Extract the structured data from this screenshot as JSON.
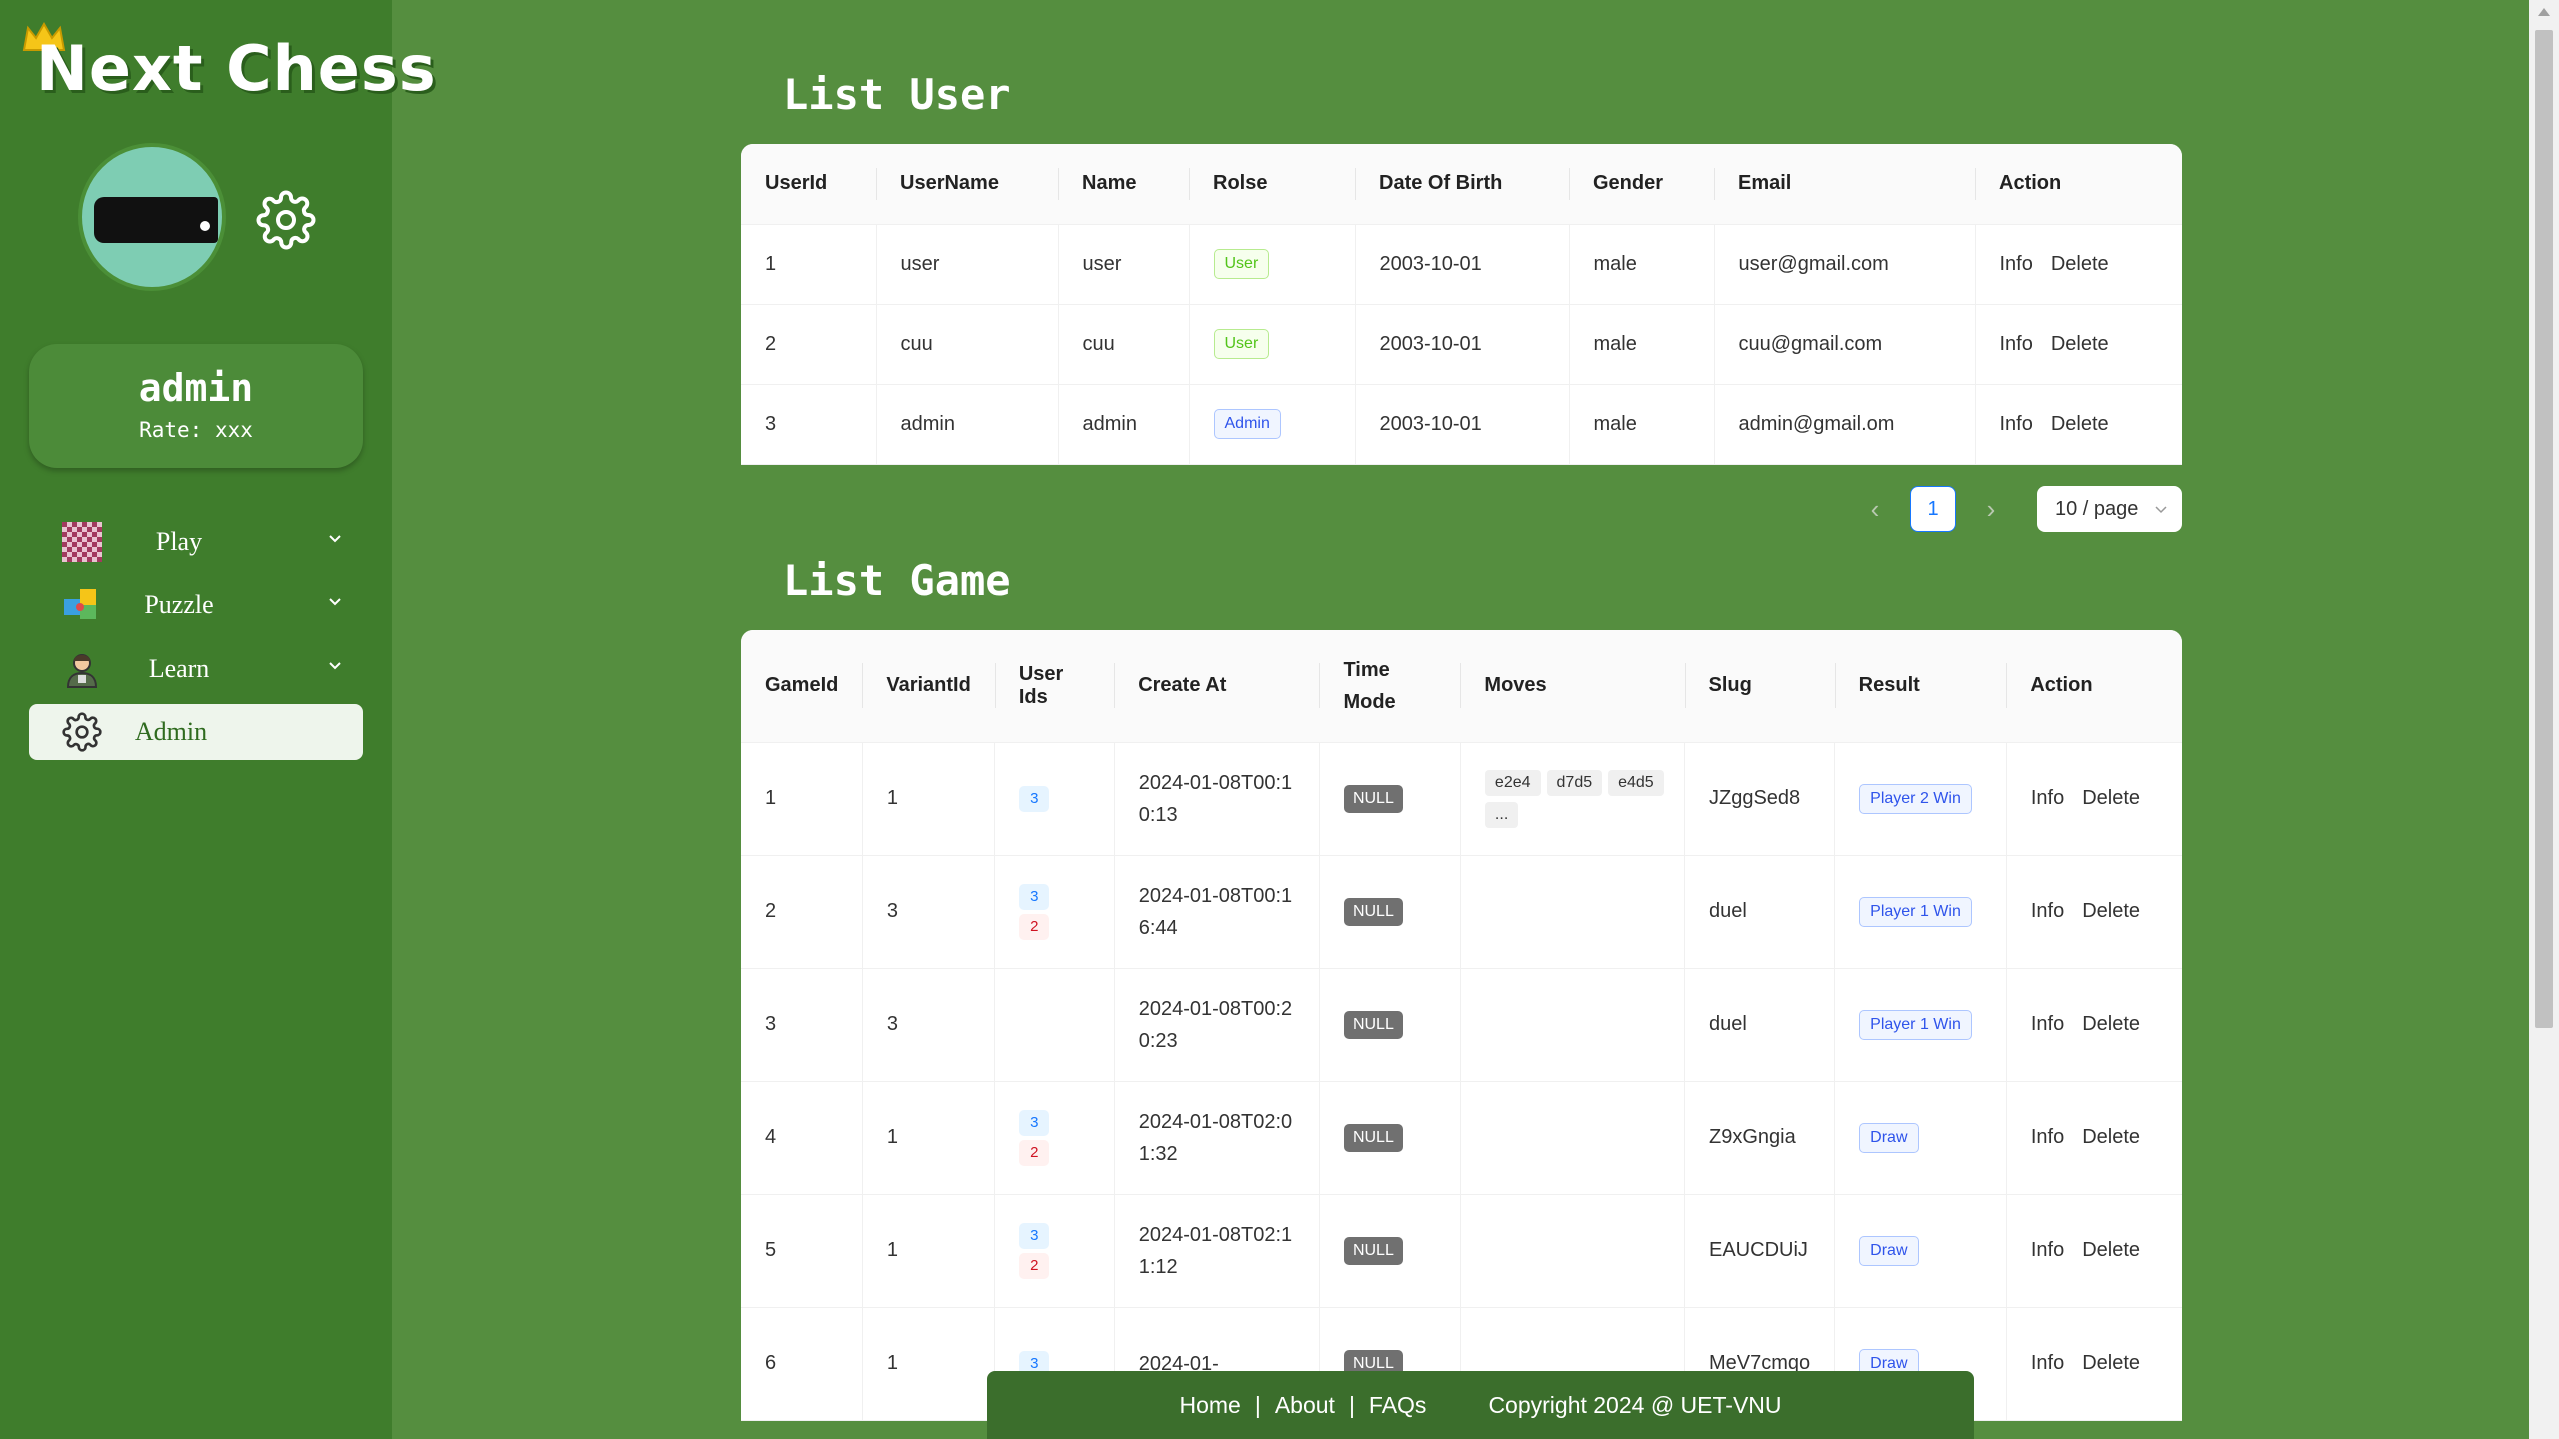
{
  "app": {
    "name": "Next Chess"
  },
  "profile": {
    "username": "admin",
    "rate": "Rate: xxx"
  },
  "nav": [
    {
      "label": "Play",
      "icon": "chessboard-icon"
    },
    {
      "label": "Puzzle",
      "icon": "puzzle-icon"
    },
    {
      "label": "Learn",
      "icon": "teacher-icon"
    },
    {
      "label": "Admin",
      "icon": "gear-icon"
    }
  ],
  "users": {
    "title": "List User",
    "columns": [
      "UserId",
      "UserName",
      "Name",
      "Rolse",
      "Date Of Birth",
      "Gender",
      "Email",
      "Action"
    ],
    "rows": [
      {
        "id": "1",
        "username": "user",
        "name": "user",
        "role": "User",
        "dob": "2003-10-01",
        "gender": "male",
        "email": "user@gmail.com"
      },
      {
        "id": "2",
        "username": "cuu",
        "name": "cuu",
        "role": "User",
        "dob": "2003-10-01",
        "gender": "male",
        "email": "cuu@gmail.com"
      },
      {
        "id": "3",
        "username": "admin",
        "name": "admin",
        "role": "Admin",
        "dob": "2003-10-01",
        "gender": "male",
        "email": "admin@gmail.om"
      }
    ],
    "actions": {
      "info": "Info",
      "delete": "Delete"
    }
  },
  "pagination": {
    "current": "1",
    "page_size": "10 / page",
    "prev": "‹",
    "next": "›"
  },
  "games": {
    "title": "List Game",
    "columns": [
      "GameId",
      "VariantId",
      "User Ids",
      "Create At",
      "Time Mode",
      "Moves",
      "Slug",
      "Result",
      "Action"
    ],
    "rows": [
      {
        "id": "1",
        "variant": "1",
        "users": [
          "3"
        ],
        "created": "2024-01-08T00:10:13",
        "time": "NULL",
        "moves": [
          "e2e4",
          "d7d5",
          "e4d5",
          "..."
        ],
        "slug": "JZggSed8",
        "result": "Player 2 Win"
      },
      {
        "id": "2",
        "variant": "3",
        "users": [
          "3",
          "2"
        ],
        "created": "2024-01-08T00:16:44",
        "time": "NULL",
        "moves": [],
        "slug": "duel",
        "result": "Player 1 Win"
      },
      {
        "id": "3",
        "variant": "3",
        "users": [],
        "created": "2024-01-08T00:20:23",
        "time": "NULL",
        "moves": [],
        "slug": "duel",
        "result": "Player 1 Win"
      },
      {
        "id": "4",
        "variant": "1",
        "users": [
          "3",
          "2"
        ],
        "created": "2024-01-08T02:01:32",
        "time": "NULL",
        "moves": [],
        "slug": "Z9xGngia",
        "result": "Draw"
      },
      {
        "id": "5",
        "variant": "1",
        "users": [
          "3",
          "2"
        ],
        "created": "2024-01-08T02:11:12",
        "time": "NULL",
        "moves": [],
        "slug": "EAUCDUiJ",
        "result": "Draw"
      },
      {
        "id": "6",
        "variant": "1",
        "users": [
          "3"
        ],
        "created": "2024-01-",
        "time": "NULL",
        "moves": [],
        "slug": "MeV7cmqo",
        "result": "Draw"
      }
    ],
    "actions": {
      "info": "Info",
      "delete": "Delete"
    }
  },
  "footer": {
    "home": "Home",
    "about": "About",
    "faqs": "FAQs",
    "sep": "|",
    "copyright": "Copyright 2024 @ UET-VNU"
  },
  "colors": {
    "background": "#558e3f",
    "sidebar": "#3f7d2c",
    "footer": "#3b6e2c",
    "accent": "#1677ff"
  }
}
